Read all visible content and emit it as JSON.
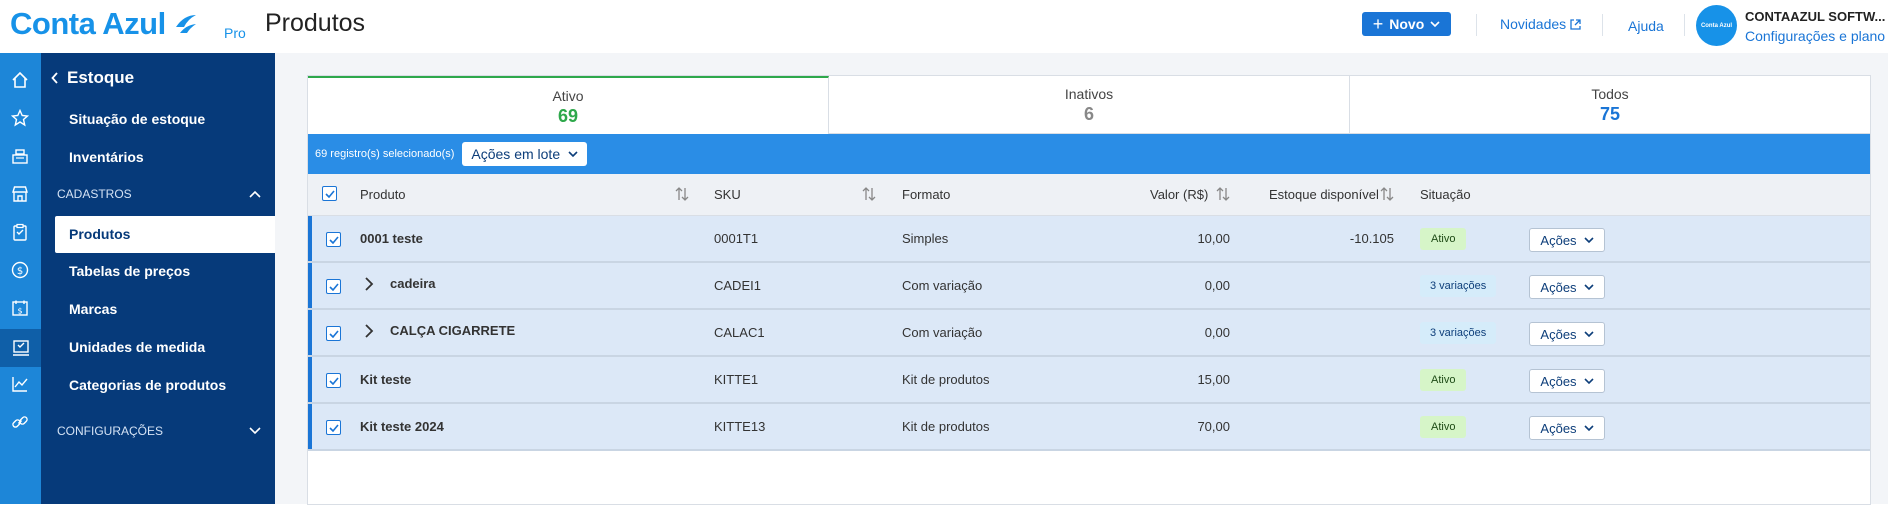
{
  "header": {
    "logo": "Conta Azul",
    "logo_pro": "Pro",
    "title": "Produtos",
    "novo_label": "Novo",
    "novidades_label": "Novidades",
    "ajuda_label": "Ajuda",
    "avatar_text": "Conta Azul",
    "company_name": "CONTAAZUL SOFTW...",
    "company_sub": "Configurações e plano",
    "accent_color": "#1792e8"
  },
  "rail": {
    "icons": [
      "home-icon",
      "star-icon",
      "cash-register-icon",
      "store-icon",
      "clipboard-icon",
      "dollar-icon",
      "calendar-dollar-icon",
      "inventory-icon",
      "chart-icon",
      "link-icon"
    ]
  },
  "sidebar": {
    "back_label": "Estoque",
    "items_top": [
      "Situação de estoque",
      "Inventários"
    ],
    "section_cadastros": "CADASTROS",
    "active_item": "Produtos",
    "items_cadastros": [
      "Tabelas de preços",
      "Marcas",
      "Unidades de medida",
      "Categorias de produtos"
    ],
    "section_config": "CONFIGURAÇÕES"
  },
  "tabs": [
    {
      "label": "Ativo",
      "count": "69",
      "color": "#2ea84b"
    },
    {
      "label": "Inativos",
      "count": "6",
      "color": "#888888"
    },
    {
      "label": "Todos",
      "count": "75",
      "color": "#1a75d6"
    }
  ],
  "bulk": {
    "selected_text": "69 registro(s) selecionado(s)",
    "button_label": "Ações em lote"
  },
  "table": {
    "columns": [
      "Produto",
      "SKU",
      "Formato",
      "Valor (R$)",
      "Estoque disponível",
      "Situação"
    ],
    "actions_label": "Ações",
    "rows": [
      {
        "produto": "0001 teste",
        "sku": "0001T1",
        "formato": "Simples",
        "valor": "10,00",
        "estoque": "-10.105",
        "situacao": "Ativo",
        "kind": "ativo",
        "expandable": false
      },
      {
        "produto": "cadeira",
        "sku": "CADEI1",
        "formato": "Com variação",
        "valor": "0,00",
        "estoque": "",
        "situacao": "3 variações",
        "kind": "var",
        "expandable": true
      },
      {
        "produto": "CALÇA CIGARRETE",
        "sku": "CALAC1",
        "formato": "Com variação",
        "valor": "0,00",
        "estoque": "",
        "situacao": "3 variações",
        "kind": "var",
        "expandable": true
      },
      {
        "produto": "Kit teste",
        "sku": "KITTE1",
        "formato": "Kit de produtos",
        "valor": "15,00",
        "estoque": "",
        "situacao": "Ativo",
        "kind": "ativo",
        "expandable": false
      },
      {
        "produto": "Kit teste 2024",
        "sku": "KITTE13",
        "formato": "Kit de produtos",
        "valor": "70,00",
        "estoque": "",
        "situacao": "Ativo",
        "kind": "ativo",
        "expandable": false
      }
    ]
  }
}
